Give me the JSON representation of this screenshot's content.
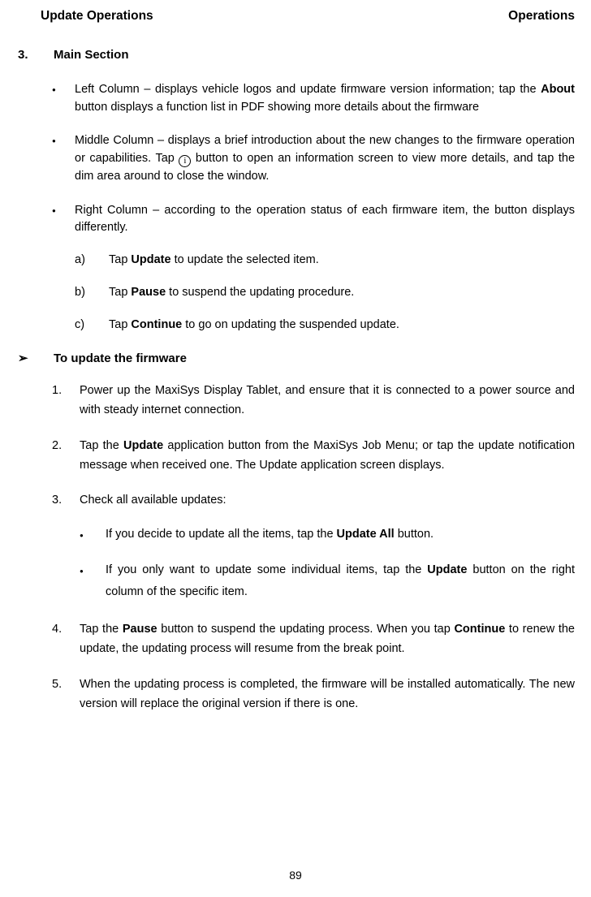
{
  "header": {
    "left": "Update Operations",
    "right": "Operations"
  },
  "section": {
    "number": "3.",
    "title": "Main Section"
  },
  "bullets": {
    "b1_pre": "Left Column – displays vehicle logos and update firmware version information; tap the ",
    "b1_bold": "About",
    "b1_post": " button displays a function list in PDF showing more details about the firmware",
    "b2_pre": "Middle Column – displays a brief introduction about the new changes to the firmware operation or capabilities. Tap ",
    "b2_post": " button to open an information screen to view more details, and tap the dim area around to close the window.",
    "b3": "Right Column – according to the operation status of each firmware item, the button displays differently."
  },
  "sub": {
    "a_label": "a)",
    "a_pre": "Tap ",
    "a_bold": "Update",
    "a_post": " to update the selected item.",
    "b_label": "b)",
    "b_pre": "Tap ",
    "b_bold": "Pause",
    "b_post": " to suspend the updating procedure.",
    "c_label": "c)",
    "c_pre": "Tap ",
    "c_bold": "Continue",
    "c_post": " to go on updating the suspended update."
  },
  "arrow": {
    "symbol": "➢",
    "title": "To update the firmware"
  },
  "steps": {
    "s1_num": "1.",
    "s1": "Power up the MaxiSys Display Tablet, and ensure that it is connected to a power source and with steady internet connection.",
    "s2_num": "2.",
    "s2_pre": "Tap the ",
    "s2_bold": "Update",
    "s2_post": " application button from the MaxiSys Job Menu; or tap the update notification message when received one. The Update application screen displays.",
    "s3_num": "3.",
    "s3": "Check all available updates:",
    "s3_sub1_pre": "If you decide to update all the items, tap the ",
    "s3_sub1_bold": "Update All",
    "s3_sub1_post": " button.",
    "s3_sub2_pre": "If you only want to update some individual items, tap the ",
    "s3_sub2_bold": "Update",
    "s3_sub2_post": " button on the right column of the specific item.",
    "s4_num": "4.",
    "s4_pre": "Tap the ",
    "s4_bold1": "Pause",
    "s4_mid": " button to suspend the updating process. When you tap ",
    "s4_bold2": "Continue",
    "s4_post": " to renew the update, the updating process will resume from the break point.",
    "s5_num": "5.",
    "s5": "When the updating process is completed, the firmware will be installed automatically. The new version will replace the original version if there is one."
  },
  "info_icon_text": "i",
  "page_number": "89"
}
